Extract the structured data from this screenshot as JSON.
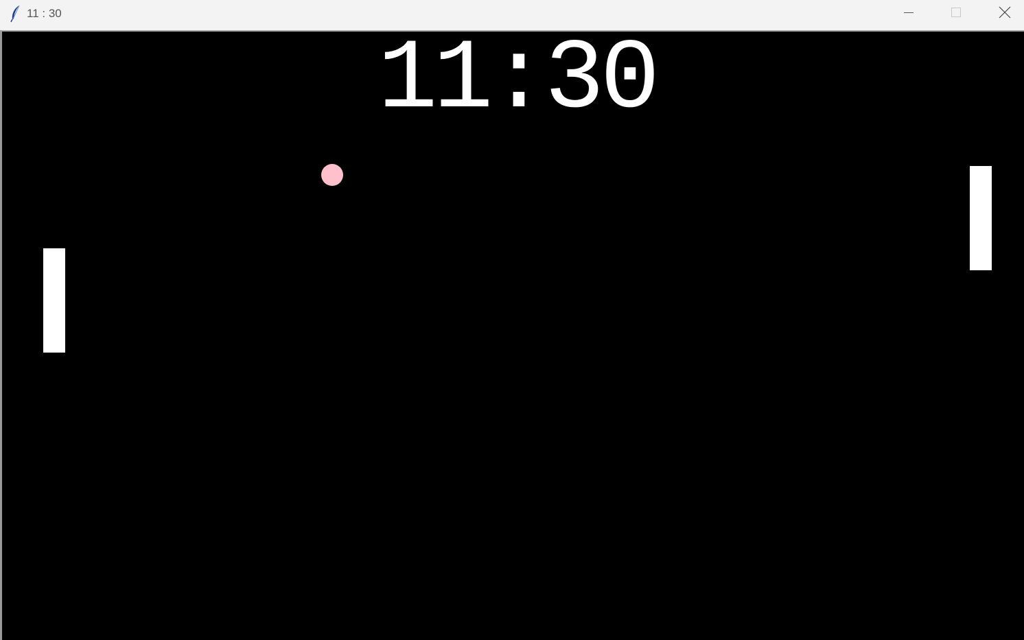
{
  "window": {
    "title": "11 : 30",
    "icon": "feather-icon",
    "controls": {
      "minimize_icon": "minimize-icon",
      "maximize_icon": "maximize-icon",
      "close_icon": "close-icon"
    }
  },
  "game": {
    "score_display": "11:30",
    "left_score": 11,
    "right_score": 30,
    "background_color": "#000000",
    "paddle_color": "#ffffff",
    "ball_color": "#ffc0cb"
  }
}
